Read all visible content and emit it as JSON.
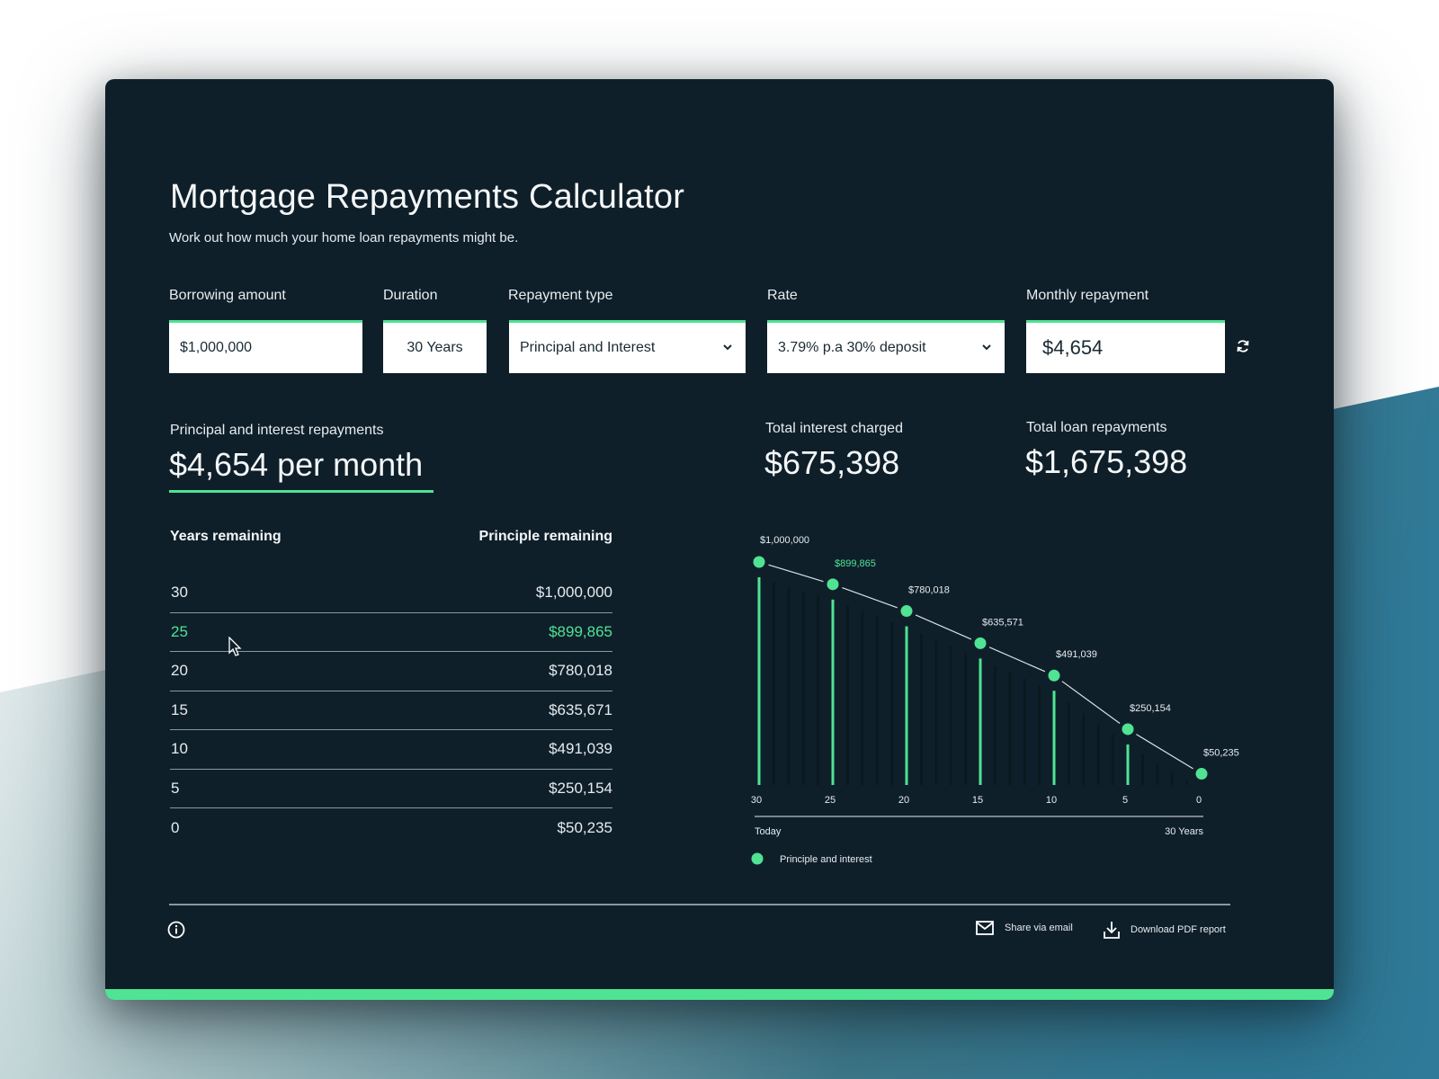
{
  "colors": {
    "accent": "#4fe393",
    "panel": "#0f1f2a",
    "text": "#f4f7f8",
    "muted": "#8a979e",
    "dark_bar": "#0a1820",
    "background_teal": "#317a97"
  },
  "header": {
    "title": "Mortgage Repayments Calculator",
    "subtitle": "Work out how much your home loan repayments might be."
  },
  "form": {
    "borrowing_amount": {
      "label": "Borrowing amount",
      "value": "$1,000,000"
    },
    "duration": {
      "label": "Duration",
      "value": "30 Years"
    },
    "repayment_type": {
      "label": "Repayment type",
      "value": "Principal and Interest",
      "icon": "chevron-down-icon"
    },
    "rate": {
      "label": "Rate",
      "value": "3.79% p.a 30% deposit",
      "icon": "chevron-down-icon"
    },
    "monthly_repayment": {
      "label": "Monthly repayment",
      "value": "$4,654"
    },
    "refresh_icon": "refresh-icon"
  },
  "summary": {
    "repayments_label": "Principal and interest repayments",
    "repayments_value": "$4,654 per month",
    "interest_label": "Total interest charged",
    "interest_value": "$675,398",
    "total_label": "Total loan repayments",
    "total_value": "$1,675,398"
  },
  "table": {
    "headers": [
      "Years remaining",
      "Principle remaining"
    ],
    "rows": [
      {
        "years": "30",
        "principle": "$1,000,000",
        "active": false
      },
      {
        "years": "25",
        "principle": "$899,865",
        "active": true
      },
      {
        "years": "20",
        "principle": "$780,018",
        "active": false
      },
      {
        "years": "15",
        "principle": "$635,671",
        "active": false
      },
      {
        "years": "10",
        "principle": "$491,039",
        "active": false
      },
      {
        "years": "5",
        "principle": "$250,154",
        "active": false
      },
      {
        "years": "0",
        "principle": "$50,235",
        "active": false
      }
    ]
  },
  "chart_data": {
    "type": "line",
    "title": "",
    "xlabel_start": "Today",
    "xlabel_end": "30 Years",
    "ylabel": "",
    "x": [
      30,
      25,
      20,
      15,
      10,
      5,
      0
    ],
    "tick_labels": [
      "30",
      "25",
      "20",
      "15",
      "10",
      "5",
      "0"
    ],
    "series": [
      {
        "name": "Principle and interest",
        "values": [
          1000000,
          899865,
          780018,
          635571,
          491039,
          250154,
          50235
        ],
        "labels": [
          "$1,000,000",
          "$899,865",
          "$780,018",
          "$635,571",
          "$491,039",
          "$250,154",
          "$50,235"
        ],
        "highlighted_index": 1
      }
    ],
    "ylim": [
      0,
      1000000
    ],
    "legend": {
      "position": "bottom-left",
      "entries": [
        "Principle and interest"
      ]
    },
    "grid": false
  },
  "footer": {
    "info_icon": "info-icon",
    "share_label": "Share via email",
    "share_icon": "mail-icon",
    "download_label": "Download PDF report",
    "download_icon": "download-icon"
  }
}
